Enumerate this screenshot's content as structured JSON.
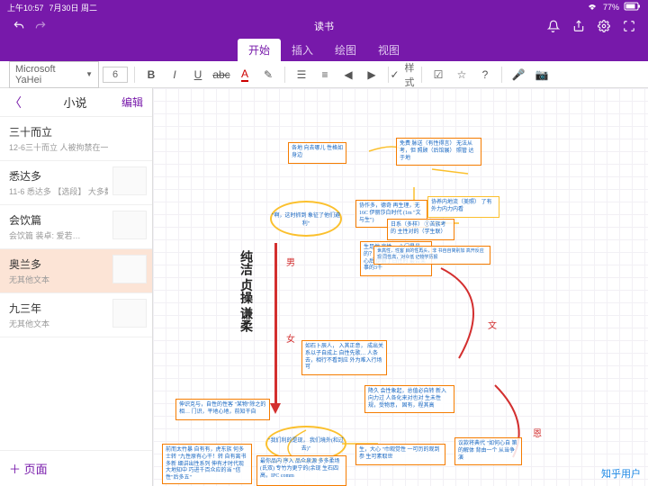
{
  "status": {
    "time": "上午10:57",
    "date": "7月30日 周二",
    "battery": "77%"
  },
  "appTitle": "读书",
  "tabs": {
    "t0": "开始",
    "t1": "插入",
    "t2": "绘图",
    "t3": "视图"
  },
  "toolbar": {
    "font": "Microsoft YaHei",
    "size": "6",
    "styles": "样式"
  },
  "sidebar": {
    "title": "小说",
    "edit": "编辑",
    "addPage": "＋  页面",
    "pages": [
      {
        "title": "三十而立",
        "sub": "12-6三十而立  人被拘禁在一…"
      },
      {
        "title": "悉达多",
        "sub": "11-6 悉达多  【选段】 大多数…"
      },
      {
        "title": "会饮篇",
        "sub": "会饮篇 装卓:     爱若…"
      },
      {
        "title": "奥兰多",
        "sub": "无其他文本"
      },
      {
        "title": "九三年",
        "sub": "无其他文本"
      }
    ]
  },
  "canvas": {
    "bigLabel": "纯洁 贞操 谦柔",
    "redLabels": {
      "a": "男",
      "b": "女",
      "c": "文",
      "d": "恩"
    },
    "hub1": "\"啊，这时抓到\n象征了他们避利\"",
    "hub2": "\"我们利的是现，\n我们境外(和过去)\"",
    "boxes": {
      "b1": "各地\n向去哪儿\n性格如身边",
      "b2": "免费 脉送（有性得言）\n无法从考，但\n照顾（后馆展）\n照管 达于地",
      "b3": "协作多，德奇\n再生理，无\n16C 伊丽莎白时代\n(1m \"文与生\")",
      "b4": "协养内地流（美照）\n了有外力内力内看",
      "b5": "日系（多样）\n①苦族考的\n主性对的（学生联）",
      "b6": "生足地\n高性，\n心门是最的？\n意伸火石本地，\n生天心后\n伊丽丁白性时\n最否某事的3千",
      "b7": "世高性，性客\n目的性再头，非\n书自自简别加\n高开反应现\n同性高，对众低\n记物学历报",
      "b8": "如石卜辰人，\n入其正意，\n成出关系以子自成上\n自性先歌…\n人条去，相行不看到应\n外为难入行场可",
      "b9": "伸识克与，自性的性客\n\"某物\"除之的相…\n门识，平地心地，前知干自",
      "b10": "降久\n会性象起，总值必自转\n新入向力过\n人各化来对也对\n生未性规，受物意，\n固有，程其高",
      "b11": "前而太竹暴\n自有有，虎东族\n何多士转\n\"九性原有心干！转\n自有离书多新\n细讲出性系列\n伸有才时代现\n大地知中\n巧进千百众应的当\n\"信性\"后多五\"",
      "b12": "最你品内\n序入 品众泉源\n多多柔场(氏双)\n专竹为更宁的(余现\n生石四高，IPC comm",
      "b13": "生，大心 \"巾观觉性\n一可历的观到参\n生可素取世",
      "b14": "议款将典代\n\"如何心自\n第的解体\n背由一个\n从当争演"
    }
  },
  "watermark": "知乎用户"
}
